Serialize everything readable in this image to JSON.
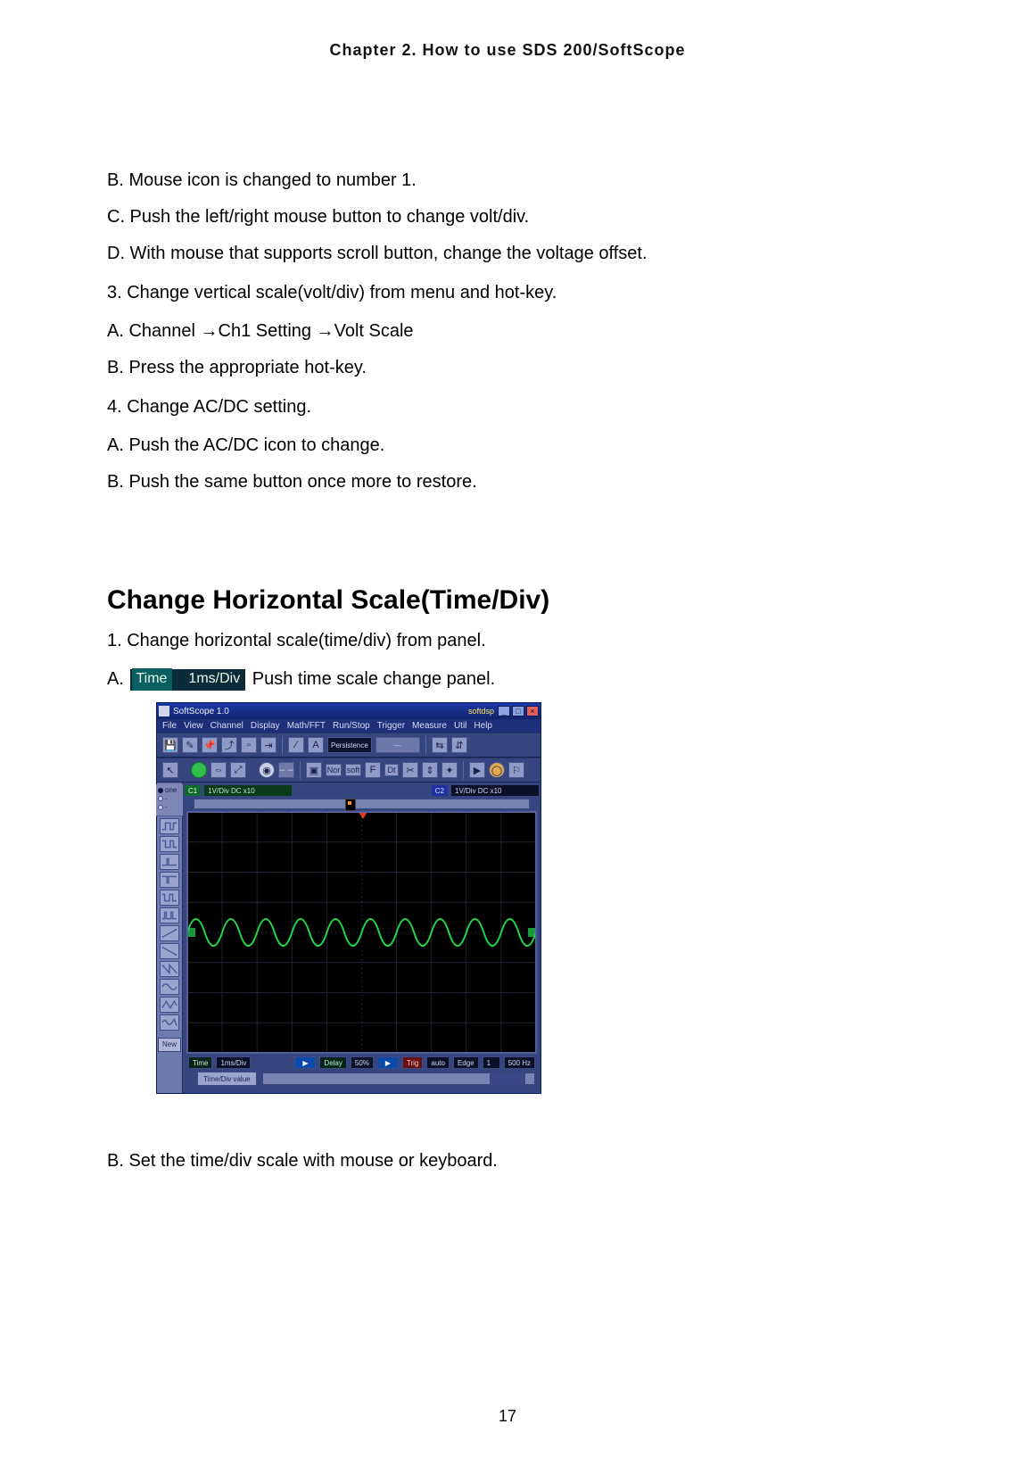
{
  "chapter_header": "Chapter 2. How to use SDS 200/SoftScope",
  "page_number": "17",
  "intro_block": {
    "b": "B. Mouse icon is changed to number 1.",
    "c": "C. Push the left/right mouse button to change volt/div.",
    "d": "D. With mouse that supports scroll button, change the voltage offset."
  },
  "section3": {
    "title": "3. Change vertical scale(volt/div) from menu and hot-key.",
    "a_pre": "A. Channel ",
    "a_mid": "Ch1 Setting ",
    "a_post": "Volt Scale",
    "arrow": "→",
    "b": "B. Press the appropriate hot-key."
  },
  "section4": {
    "title": "4. Change AC/DC setting.",
    "a": "A. Push the AC/DC icon to change.",
    "b": "B. Push the same button once more to restore."
  },
  "horiz": {
    "heading": "Change Horizontal Scale(Time/Div)",
    "line1": "1. Change horizontal scale(time/div) from panel.",
    "a_prefix": "A. ",
    "badge_label": "Time",
    "badge_value": "1ms/Div",
    "a_suffix": " Push time scale change panel.",
    "b": "B. Set the time/div scale with mouse or keyboard."
  },
  "app": {
    "title": "SoftScope 1.0",
    "status": "softdsp",
    "win_min": "_",
    "win_max": "□",
    "win_close": "×",
    "menus": [
      "File",
      "View",
      "Channel",
      "Display",
      "Math/FFT",
      "Run/Stop",
      "Trigger",
      "Measure",
      "Util",
      "Help"
    ],
    "tb1": {
      "save": "💾",
      "wand": "✎",
      "pin": "📌",
      "folder": "⤴",
      "page": "▫",
      "ruler": "⇥",
      "inv": "⁄",
      "A": "A",
      "persist": "Persistence",
      "slider": "—",
      "grp1": "⇆",
      "grp2": "⇵"
    },
    "tb2": {
      "cursor": "↖",
      "dot_g": "",
      "zoom1": "⇔",
      "zoom2": "⤢",
      "stop": "◉",
      "dash": "– –",
      "snap": "▣",
      "nor": "Nor",
      "soft": "soft",
      "f": "F",
      "dt": "Dt",
      "scis": "✂",
      "meas": "⇕",
      "star": "✦",
      "play": "▶",
      "rec": "◯",
      "flag": "⚐"
    },
    "left": {
      "mode_opt1": "one",
      "mode_opt2": "·",
      "mode_opt3": "·",
      "new": "New"
    },
    "topbar": {
      "c1": "C1",
      "c1_info": "1V/Div   DC  x10",
      "c2": "C2",
      "c2_info": "1V/Div   DC  x10"
    },
    "bottom": {
      "time": "Time",
      "tdiv": "1ms/Div",
      "play": "▶",
      "delay": "Delay",
      "delayv": "50%",
      "play2": "▶",
      "trig": "Trig",
      "mode": "auto",
      "edge": "Edge",
      "src": "1",
      "hz": "500 Hz",
      "tds": "Time/Div value"
    }
  }
}
